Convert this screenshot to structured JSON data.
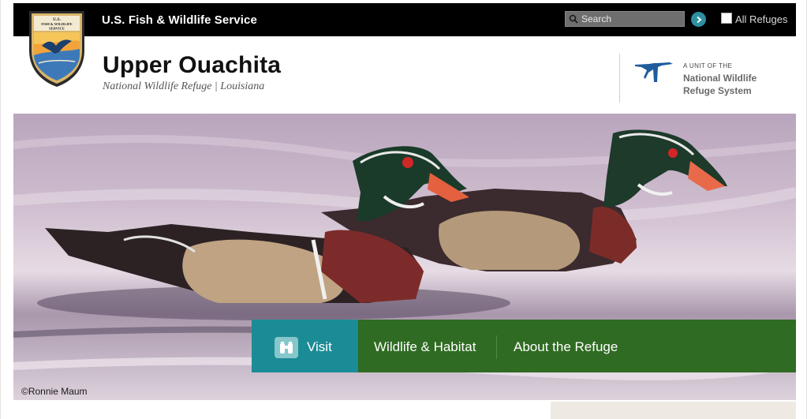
{
  "topbar": {
    "agency_name": "U.S. Fish & Wildlife Service",
    "search_placeholder": "Search",
    "all_refuges_label": "All Refuges"
  },
  "logo": {
    "text_top": "U.S. FISH & WILDLIFE SERVICE"
  },
  "header": {
    "title": "Upper Ouachita",
    "subtitle": "National Wildlife Refuge | Louisiana",
    "nwrs_small": "A UNIT OF THE",
    "nwrs_line1": "National Wildlife",
    "nwrs_line2": "Refuge System"
  },
  "hero": {
    "photo_credit": "©Ronnie Maum"
  },
  "nav": {
    "items": [
      {
        "label": "Visit",
        "icon": "binoculars-icon"
      },
      {
        "label": "Wildlife & Habitat"
      },
      {
        "label": "About the Refuge"
      }
    ]
  },
  "colors": {
    "topbar": "#000000",
    "visit_teal": "#1b8b96",
    "nav_green": "#2f6b22",
    "go_button": "#2e8fa0"
  }
}
